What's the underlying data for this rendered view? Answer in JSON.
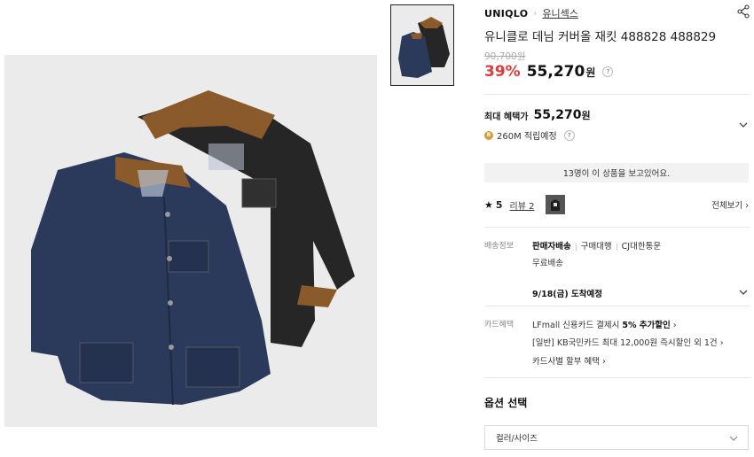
{
  "product": {
    "brand": "UNIQLO",
    "category": "유니섹스",
    "title": "유니클로 데님 커버올 재킷 488828 488829",
    "original_price": "90,700원",
    "discount": "39%",
    "price": "55,270",
    "currency": "원",
    "help_symbol": "?"
  },
  "benefit": {
    "label": "최대 혜택가",
    "price": "55,270",
    "currency": "원",
    "point_badge": "B",
    "points": "260M 적립예정",
    "help_symbol": "?"
  },
  "viewers_text": "13명이 이 상품을 보고있어요.",
  "review": {
    "star": "★",
    "rating": "5",
    "link_label": "리뷰 2",
    "see_all": "전체보기"
  },
  "shipping": {
    "label": "배송정보",
    "seller_shipping": "판매자배송",
    "purchase_agent": "구매대행",
    "carrier": "CJ대한통운",
    "free_shipping": "무료배송",
    "arrival": "9/18(금) 도착예정"
  },
  "card": {
    "label": "카드혜택",
    "line1_prefix": "LFmall 신용카드 결제시",
    "line1_bold": "5% 추가할인",
    "line2": "[일반] KB국민카드 최대 12,000원 즉시할인 외 1건",
    "line3": "카드사별 할부 혜택"
  },
  "options": {
    "title": "옵션 선택",
    "select_placeholder": "컬러/사이즈"
  },
  "colors": {
    "discount": "#e03b3b",
    "denim": "#2b3a5a",
    "black_denim": "#2a2a2a",
    "corduroy": "#8a5a2b",
    "background": "#ebebec"
  },
  "icons": [
    "share-icon",
    "chevron-down-icon",
    "chevron-right-icon",
    "star-icon",
    "point-badge-icon",
    "help-icon"
  ]
}
